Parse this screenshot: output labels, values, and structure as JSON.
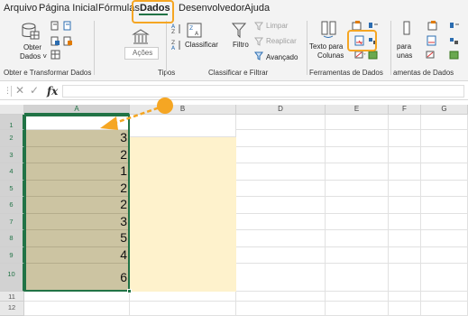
{
  "menu": {
    "tabs": [
      "Arquivo",
      "Página Inicial",
      "Fórmulas",
      "Dados",
      "Desenvolvedor",
      "Ajuda"
    ],
    "active": "Dados"
  },
  "ribbon": {
    "get_data": {
      "line1": "Obter",
      "line2": "Dados ˅"
    },
    "stocks": "Ações",
    "sort": "Classificar",
    "filter": "Filtro",
    "clear": "Limpar",
    "reapply": "Reaplicar",
    "advanced": "Avançado",
    "text_to_cols": {
      "line1": "Texto para",
      "line2": "Colunas"
    },
    "partial_text": {
      "line1": "para",
      "line2": "unas"
    },
    "groups": {
      "get_transform": "Obter e Transformar Dados",
      "types": "Tipos",
      "sort_filter": "Classificar e Filtrar",
      "data_tools": "Ferramentas de Dados",
      "data_tools_partial": "amentas de Dados"
    }
  },
  "formula_bar": {
    "fx": "fx",
    "value": ""
  },
  "sheet": {
    "columns": [
      "A",
      "B",
      "D",
      "E",
      "F",
      "G"
    ],
    "selected_column": "A",
    "rows": [
      "1",
      "2",
      "3",
      "4",
      "5",
      "6",
      "7",
      "8",
      "9",
      "10",
      "11",
      "12"
    ],
    "column_a_values": [
      "",
      "3",
      "2",
      "1",
      "2",
      "2",
      "3",
      "5",
      "4",
      "6",
      "",
      ""
    ]
  },
  "colors": {
    "accent": "#217346",
    "highlight": "#f5a623",
    "data_fill": "#ccc4a2",
    "column_b_fill": "#fef2cc"
  }
}
